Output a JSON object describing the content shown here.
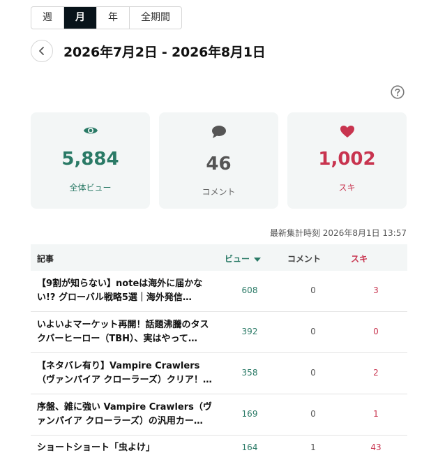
{
  "period_tabs": [
    "週",
    "月",
    "年",
    "全期間"
  ],
  "active_tab": "月",
  "date_range": "2026年7月2日  -  2026年8月1日",
  "summary": {
    "views": {
      "value": "5,884",
      "label": "全体ビュー",
      "icon": "eye-icon",
      "color": "#2a7a66"
    },
    "comments": {
      "value": "46",
      "label": "コメント",
      "icon": "comment-bubble-icon",
      "color": "#555555"
    },
    "likes": {
      "value": "1,002",
      "label": "スキ",
      "icon": "heart-icon",
      "color": "#c8344f"
    }
  },
  "last_updated": "最新集計時刻 2026年8月1日 13:57",
  "table": {
    "headers": {
      "article": "記事",
      "views": "ビュー",
      "comments": "コメント",
      "likes": "スキ"
    },
    "sort_column": "views",
    "rows": [
      {
        "title": "【9割が知らない】noteは海外に届かない!? グローバル戦略5選｜海外発信…",
        "views": "608",
        "comments": "0",
        "likes": "3"
      },
      {
        "title": "いよいよマーケット再開！話題沸騰のタスクバーヒーロー（TBH）、実はやって…",
        "views": "392",
        "comments": "0",
        "likes": "0"
      },
      {
        "title": "【ネタバレ有り】Vampire Crawlers（ヴァンパイア クローラーズ）クリア！感想…",
        "views": "358",
        "comments": "0",
        "likes": "2"
      },
      {
        "title": "序盤、雑に強い Vampire Crawlers（ヴァンパイア クローラーズ）の汎用カー…",
        "views": "169",
        "comments": "0",
        "likes": "1"
      },
      {
        "title": "ショートショート「虫よけ」",
        "views": "164",
        "comments": "1",
        "likes": "43"
      }
    ]
  }
}
